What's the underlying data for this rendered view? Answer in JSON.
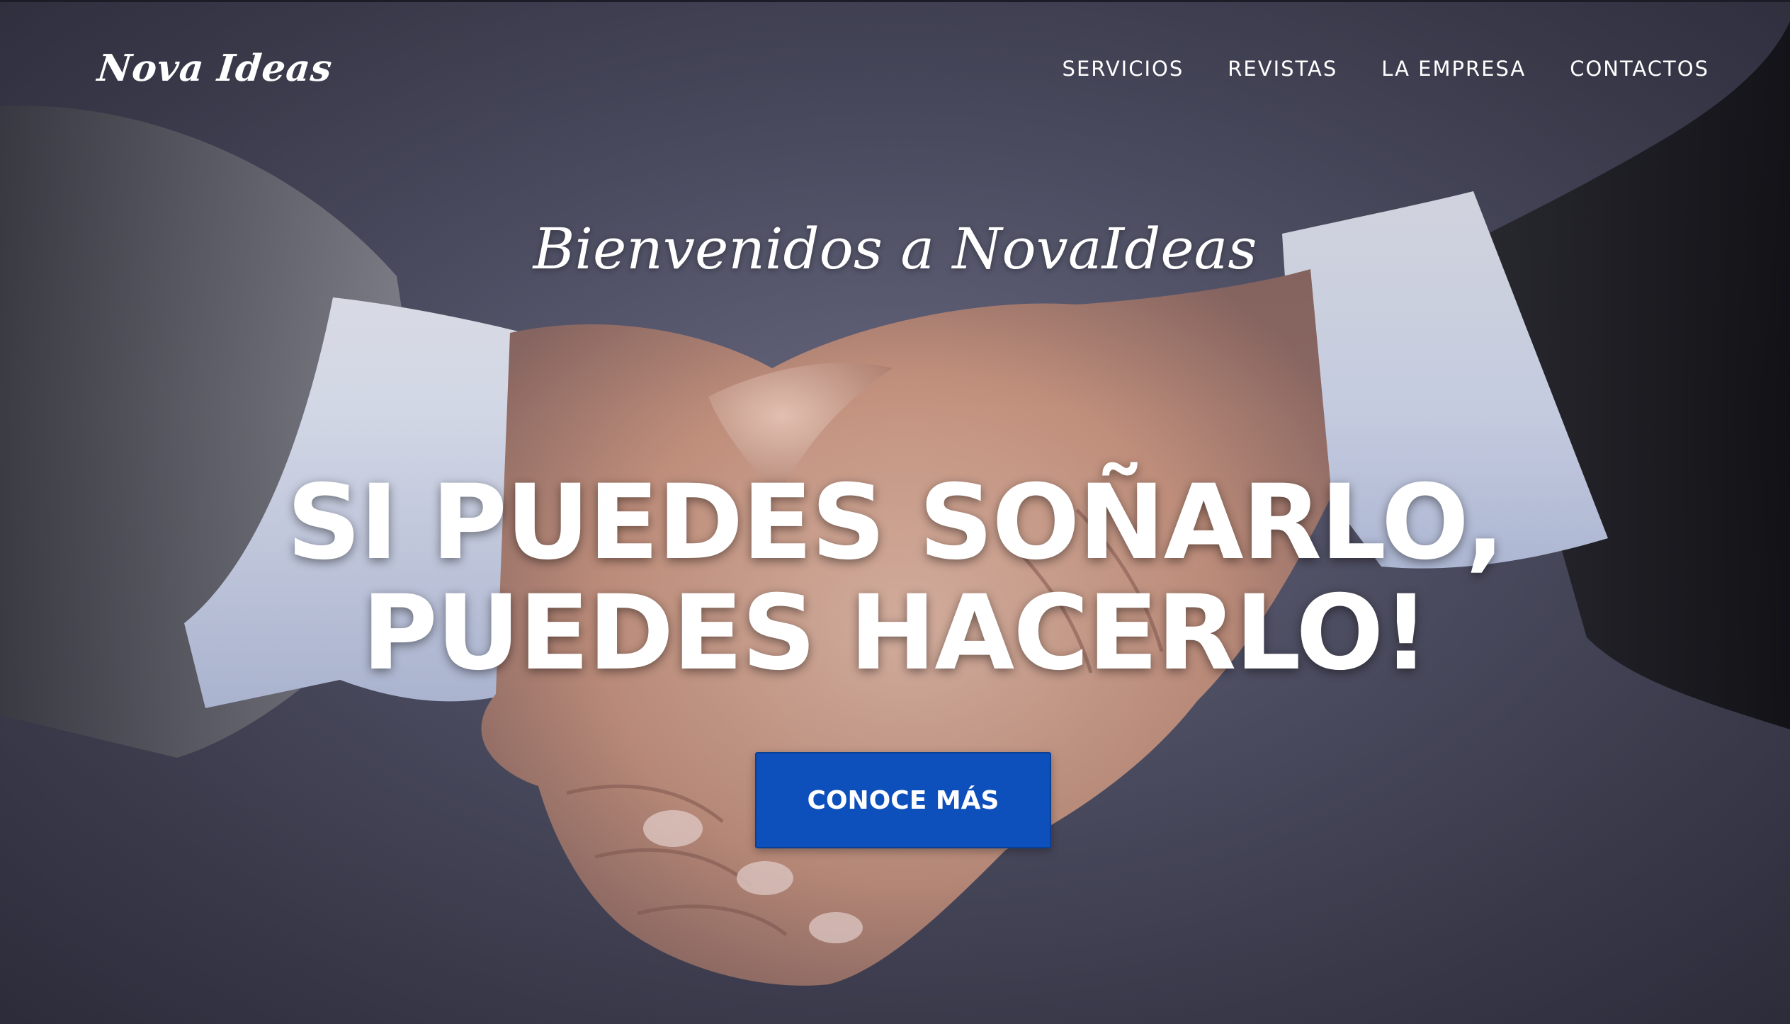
{
  "brand": {
    "logo_text": "Nova Ideas"
  },
  "nav": {
    "items": [
      {
        "label": "SERVICIOS"
      },
      {
        "label": "REVISTAS"
      },
      {
        "label": "LA EMPRESA"
      },
      {
        "label": "CONTACTOS"
      }
    ]
  },
  "hero": {
    "welcome": "Bienvenidos a NovaIdeas",
    "headline_line1": "SI PUEDES SOÑARLO,",
    "headline_line2": "PUEDES HACERLO!",
    "cta_label": "CONOCE MÁS",
    "background_image": "handshake-photo"
  },
  "colors": {
    "accent": "#0d4fbb",
    "text": "#ffffff",
    "background": "#4a4a5e"
  }
}
